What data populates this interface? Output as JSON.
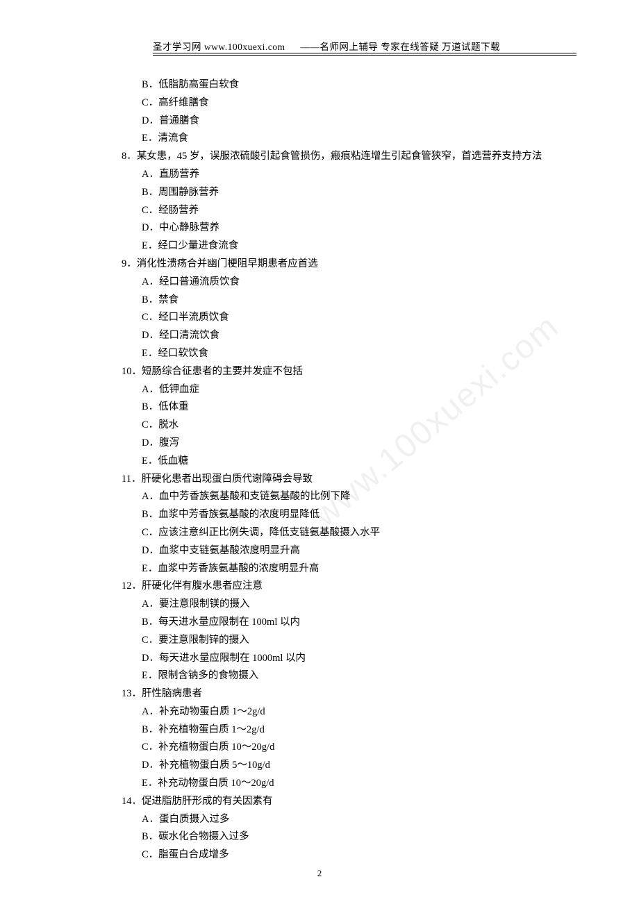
{
  "header": {
    "left": "圣才学习网 www.100xuexi.com",
    "right": "——名师网上辅导  专家在线答疑  万道试题下载"
  },
  "watermark": "www.100xuexi.com",
  "pageNumber": "2",
  "questions": [
    {
      "number": "",
      "stem": "",
      "options": [
        "B．低脂肪高蛋白软食",
        "C．高纤维膳食",
        "D．普通膳食",
        "E．清流食"
      ]
    },
    {
      "number": "8．",
      "stem": "某女患，45 岁，误服浓硫酸引起食管损伤，瘢痕粘连增生引起食管狭窄，首选营养支持方法",
      "options": [
        "A．直肠营养",
        "B．周围静脉营养",
        "C．经肠营养",
        "D．中心静脉营养",
        "E．经口少量进食流食"
      ]
    },
    {
      "number": "9．",
      "stem": "消化性溃疡合并幽门梗阻早期患者应首选",
      "options": [
        "A．经口普通流质饮食",
        "B．禁食",
        "C．经口半流质饮食",
        "D．经口清流饮食",
        "E．经口软饮食"
      ]
    },
    {
      "number": "10．",
      "stem": "短肠综合征患者的主要并发症不包括",
      "options": [
        "A．低钾血症",
        "B．低体重",
        "C．脱水",
        "D．腹泻",
        "E．低血糖"
      ]
    },
    {
      "number": "11．",
      "stem": "肝硬化患者出现蛋白质代谢障碍会导致",
      "options": [
        "A．血中芳香族氨基酸和支链氨基酸的比例下降",
        "B．血浆中芳香族氨基酸的浓度明显降低",
        "C．应该注意纠正比例失调，降低支链氨基酸摄入水平",
        "D．血浆中支链氨基酸浓度明显升高",
        "E．血浆中芳香族氨基酸的浓度明显升高"
      ]
    },
    {
      "number": "12．",
      "stem": "肝硬化伴有腹水患者应注意",
      "options": [
        "A．要注意限制镁的摄入",
        "B．每天进水量应限制在 100ml 以内",
        "C．要注意限制锌的摄入",
        "D．每天进水量应限制在 1000ml 以内",
        "E．限制含钠多的食物摄入"
      ]
    },
    {
      "number": "13．",
      "stem": "肝性脑病患者",
      "options": [
        "A．补充动物蛋白质 1～2g/d",
        "B．补充植物蛋白质 1～2g/d",
        "C．补充植物蛋白质 10～20g/d",
        "D．补充植物蛋白质 5～10g/d",
        "E．补充动物蛋白质 10～20g/d"
      ]
    },
    {
      "number": "14．",
      "stem": "促进脂肪肝形成的有关因素有",
      "options": [
        "A．蛋白质摄入过多",
        "B．碳水化合物摄入过多",
        "C．脂蛋白合成增多"
      ]
    }
  ]
}
